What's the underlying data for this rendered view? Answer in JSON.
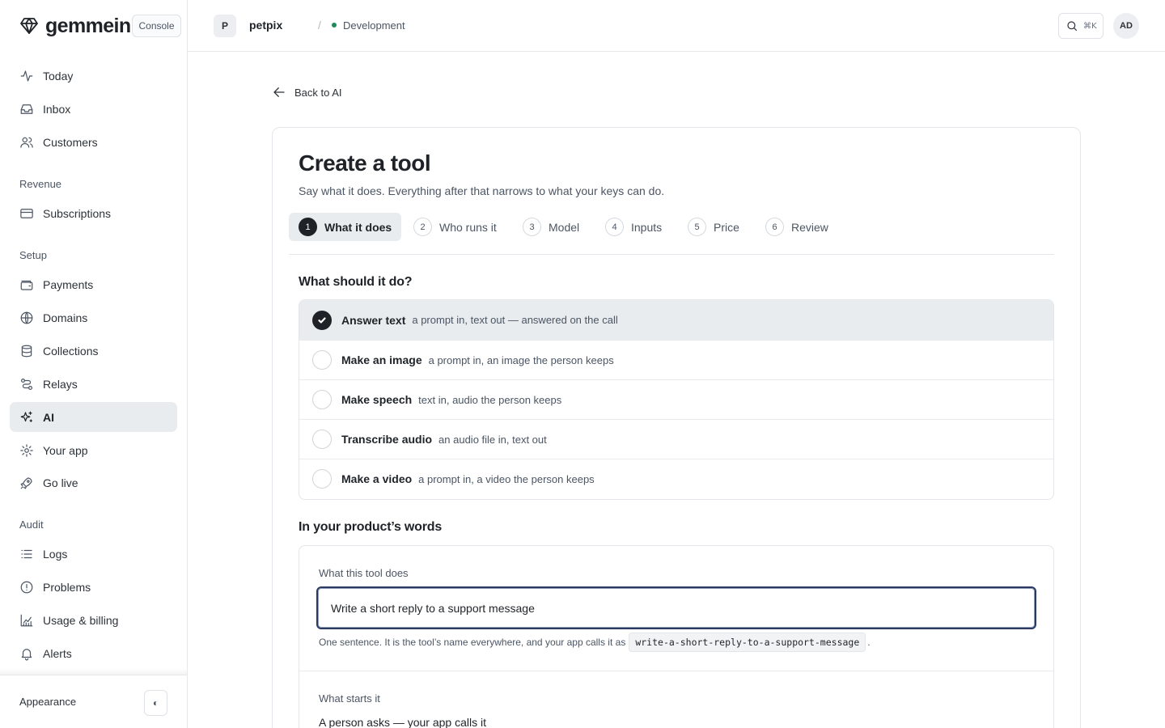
{
  "brand": {
    "name": "gemmein",
    "badge": "Console"
  },
  "sidebar": {
    "items_top": [
      {
        "label": "Today",
        "icon": "activity-icon"
      },
      {
        "label": "Inbox",
        "icon": "inbox-icon"
      },
      {
        "label": "Customers",
        "icon": "users-icon"
      }
    ],
    "sections": {
      "revenue": "Revenue",
      "setup": "Setup",
      "audit": "Audit"
    },
    "revenue_items": [
      {
        "label": "Subscriptions",
        "icon": "credit-card-icon"
      }
    ],
    "setup_items": [
      {
        "label": "Payments",
        "icon": "wallet-icon"
      },
      {
        "label": "Domains",
        "icon": "globe-icon"
      },
      {
        "label": "Collections",
        "icon": "database-icon"
      },
      {
        "label": "Relays",
        "icon": "route-icon"
      },
      {
        "label": "AI",
        "icon": "sparkles-icon",
        "active": true
      },
      {
        "label": "Your app",
        "icon": "gear-icon"
      },
      {
        "label": "Go live",
        "icon": "rocket-icon"
      }
    ],
    "audit_items": [
      {
        "label": "Logs",
        "icon": "list-icon"
      },
      {
        "label": "Problems",
        "icon": "alert-circle-icon"
      },
      {
        "label": "Usage & billing",
        "icon": "chart-icon"
      },
      {
        "label": "Alerts",
        "icon": "bell-icon"
      }
    ],
    "footer": {
      "label": "Appearance",
      "toggle": "◐"
    }
  },
  "topbar": {
    "project_initial": "P",
    "project_name": "petpix",
    "separator": "/",
    "environment": "Development",
    "search_shortcut": "⌘K",
    "user_initials": "AD"
  },
  "main": {
    "back_label": "Back to AI",
    "title": "Create a tool",
    "subtitle": "Say what it does. Everything after that narrows to what your keys can do.",
    "steps": [
      {
        "num": "1",
        "label": "What it does",
        "active": true
      },
      {
        "num": "2",
        "label": "Who runs it"
      },
      {
        "num": "3",
        "label": "Model"
      },
      {
        "num": "4",
        "label": "Inputs"
      },
      {
        "num": "5",
        "label": "Price"
      },
      {
        "num": "6",
        "label": "Review"
      }
    ],
    "question": "What should it do?",
    "options": [
      {
        "label": "Answer text",
        "desc": "a prompt in, text out — answered on the call",
        "selected": true
      },
      {
        "label": "Make an image",
        "desc": "a prompt in, an image the person keeps"
      },
      {
        "label": "Make speech",
        "desc": "text in, audio the person keeps"
      },
      {
        "label": "Transcribe audio",
        "desc": "an audio file in, text out"
      },
      {
        "label": "Make a video",
        "desc": "a prompt in, a video the person keeps"
      }
    ],
    "words_title": "In your product’s words",
    "tool_does_label": "What this tool does",
    "tool_does_value": "Write a short reply to a support message",
    "help_text": "One sentence. It is the tool’s name everywhere, and your app calls it as",
    "slug": "write-a-short-reply-to-a-support-message",
    "help_end": ".",
    "starts_label": "What starts it",
    "starts_value": "A person asks — your app calls it"
  },
  "colors": {
    "active_bg": "#e9ecef",
    "ink": "#1f2328",
    "env_dot": "#1f8a5b",
    "focus_ring": "#2a3a63"
  }
}
